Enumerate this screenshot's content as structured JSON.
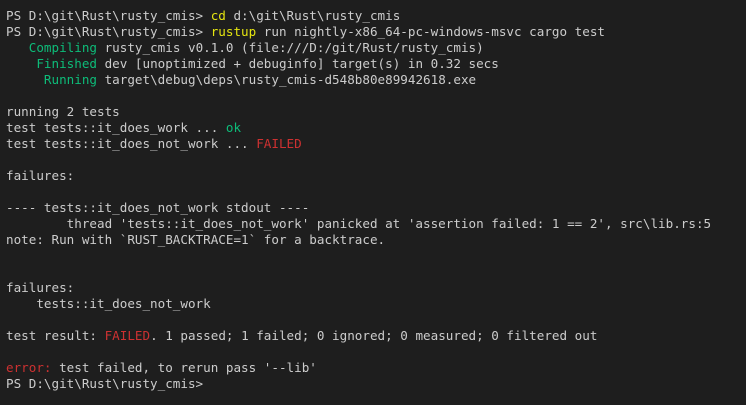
{
  "lines": {
    "l1": {
      "prompt": "PS D:\\git\\Rust\\rusty_cmis> ",
      "cmd": "cd",
      "args": " d:\\git\\Rust\\rusty_cmis"
    },
    "l2": {
      "prompt": "PS D:\\git\\Rust\\rusty_cmis> ",
      "cmd": "rustup",
      "args": " run nightly-x86_64-pc-windows-msvc cargo test"
    },
    "l3": {
      "status": "   Compiling",
      "text": " rusty_cmis v0.1.0 (file:///D:/git/Rust/rusty_cmis)"
    },
    "l4": {
      "status": "    Finished",
      "text": " dev [unoptimized + debuginfo] target(s) in 0.32 secs"
    },
    "l5": {
      "status": "     Running",
      "text": " target\\debug\\deps\\rusty_cmis-d548b80e89942618.exe"
    },
    "l6": "",
    "l7": "running 2 tests",
    "l8": {
      "text": "test tests::it_does_work ... ",
      "result": "ok"
    },
    "l9": {
      "text": "test tests::it_does_not_work ... ",
      "result": "FAILED"
    },
    "l10": "",
    "l11": "failures:",
    "l12": "",
    "l13": "---- tests::it_does_not_work stdout ----",
    "l14": "        thread 'tests::it_does_not_work' panicked at 'assertion failed: 1 == 2', src\\lib.rs:5",
    "l15": "note: Run with `RUST_BACKTRACE=1` for a backtrace.",
    "l16": "",
    "l17": "",
    "l18": "failures:",
    "l19": "    tests::it_does_not_work",
    "l20": "",
    "l21": {
      "prefix": "test result: ",
      "failed": "FAILED",
      "rest": ". 1 passed; 1 failed; 0 ignored; 0 measured; 0 filtered out"
    },
    "l22": "",
    "l23": {
      "error": "error:",
      "rest": " test failed, to rerun pass '--lib'"
    },
    "l24": {
      "prompt": "PS D:\\git\\Rust\\rusty_cmis>"
    }
  },
  "colors": {
    "background": "#1e1e1e",
    "text": "#cccccc",
    "command": "#e5e510",
    "success": "#0dbc79",
    "error": "#cd3131"
  }
}
